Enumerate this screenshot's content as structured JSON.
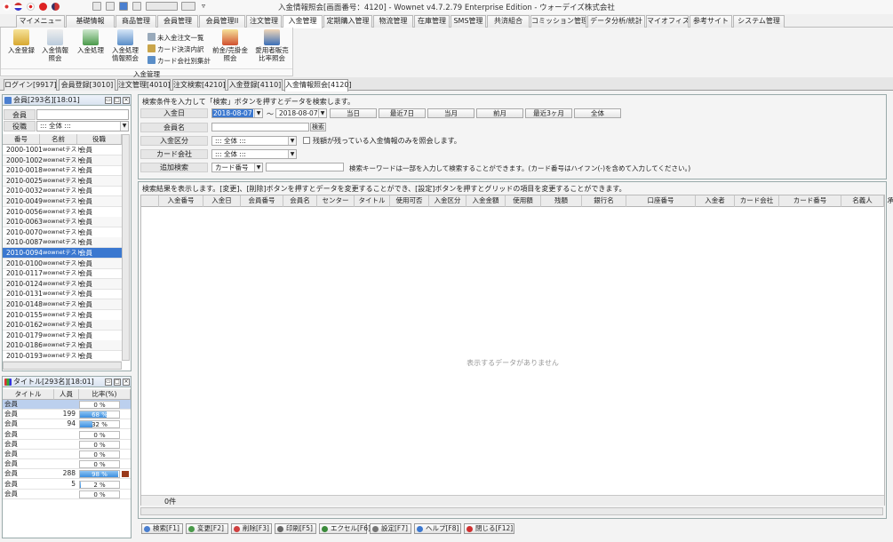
{
  "window": {
    "title": "入金情報照会[画面番号：4120] - Wownet v4.7.2.79 Enterprise Edition - ウォーデイズ株式会社"
  },
  "menu": {
    "tabs": [
      "マイメニュー",
      "基礎情報",
      "商品管理",
      "会員管理",
      "会員管理II",
      "注文管理",
      "入金管理",
      "定期購入管理",
      "物流管理",
      "在庫管理",
      "SMS管理",
      "共済組合",
      "コミッション管理",
      "データ分析/統計",
      "マイオフィス",
      "参考サイト",
      "システム管理"
    ],
    "active": "入金管理"
  },
  "ribbon": {
    "buttons": [
      {
        "label": "入金登録"
      },
      {
        "label": "入金情報\n照会"
      },
      {
        "label": "入金処理"
      },
      {
        "label": "入金処理\n情報照会"
      }
    ],
    "small": [
      "未入金注文一覧",
      "カード決済内訳",
      "カード会社別集計"
    ],
    "right": [
      {
        "label": "前金/売掛金\n照会"
      },
      {
        "label": "愛用者販売\n比率照会"
      }
    ],
    "group": "入金管理"
  },
  "window_tabs": [
    "ログイン[9917]",
    "会員登録[3010]",
    "注文管理[4010]",
    "注文検索[4210]",
    "入金登録[4110]",
    "入金情報照会[4120]"
  ],
  "members_panel": {
    "title": "会員[293名][18:01]",
    "filter_member_label": "会員",
    "filter_role_label": "役職",
    "filter_role_value": "::: 全体 :::",
    "columns": [
      "番号",
      "名前",
      "役職"
    ],
    "rows": [
      [
        "2000-1001",
        "wownetテスト",
        "会員"
      ],
      [
        "2000-1002",
        "wownetテスト",
        "会員"
      ],
      [
        "2010-0018",
        "wownetテスト",
        "会員"
      ],
      [
        "2010-0025",
        "wownetテスト",
        "会員"
      ],
      [
        "2010-0032",
        "wownetテスト",
        "会員"
      ],
      [
        "2010-0049",
        "wownetテスト",
        "会員"
      ],
      [
        "2010-0056",
        "wownetテスト",
        "会員"
      ],
      [
        "2010-0063",
        "wownetテスト",
        "会員"
      ],
      [
        "2010-0070",
        "wownetテスト",
        "会員"
      ],
      [
        "2010-0087",
        "wownetテスト",
        "会員"
      ],
      [
        "2010-0094",
        "wownetテスト",
        "会員"
      ],
      [
        "2010-0100",
        "wownetテスト",
        "会員"
      ],
      [
        "2010-0117",
        "wownetテスト",
        "会員"
      ],
      [
        "2010-0124",
        "wownetテスト",
        "会員"
      ],
      [
        "2010-0131",
        "wownetテスト",
        "会員"
      ],
      [
        "2010-0148",
        "wownetテスト",
        "会員"
      ],
      [
        "2010-0155",
        "wownetテスト",
        "会員"
      ],
      [
        "2010-0162",
        "wownetテスト",
        "会員"
      ],
      [
        "2010-0179",
        "wownetテスト",
        "会員"
      ],
      [
        "2010-0186",
        "wownetテスト",
        "会員"
      ],
      [
        "2010-0193",
        "wownetテスト",
        "会員"
      ]
    ],
    "selected_index": 10
  },
  "title_panel": {
    "title": "タイトル[293名][18:01]",
    "columns": [
      "タイトル",
      "人員",
      "比率(%)"
    ],
    "rows": [
      {
        "name": "会員",
        "count": "",
        "pct": 0,
        "label": "0 %"
      },
      {
        "name": "会員",
        "count": "199",
        "pct": 68,
        "label": "68 %"
      },
      {
        "name": "会員",
        "count": "94",
        "pct": 32,
        "label": "32 %"
      },
      {
        "name": "会員",
        "count": "",
        "pct": 0,
        "label": "0 %"
      },
      {
        "name": "会員",
        "count": "",
        "pct": 0,
        "label": "0 %"
      },
      {
        "name": "会員",
        "count": "",
        "pct": 0,
        "label": "0 %"
      },
      {
        "name": "会員",
        "count": "",
        "pct": 0,
        "label": "0 %"
      },
      {
        "name": "会員",
        "count": "288",
        "pct": 98,
        "label": "98 %"
      },
      {
        "name": "会員",
        "count": "5",
        "pct": 2,
        "label": "2 %"
      },
      {
        "name": "会員",
        "count": "",
        "pct": 0,
        "label": "0 %"
      }
    ]
  },
  "search": {
    "hint": "検索条件を入力して「検索」ボタンを押すとデータを検索します。",
    "date_label": "入金日",
    "date_from": "2018-08-07",
    "tilde": "～",
    "date_to": "2018-08-07",
    "quick": [
      "当日",
      "最近7日",
      "当月",
      "前月",
      "最近3ヶ月",
      "全体"
    ],
    "member_label": "会員名",
    "member_search_btn": "検索",
    "kind_label": "入金区分",
    "kind_value": "::: 全体 :::",
    "remaining_check": "残額が残っている入金情報のみを照会します。",
    "card_label": "カード会社",
    "card_value": "::: 全体 :::",
    "extra_label": "追加検索",
    "extra_field": "カード番号",
    "extra_hint": "検索キーワードは一部を入力して検索することができます。(カード番号はハイフン(-)を含めて入力してください。)"
  },
  "results": {
    "hint": "検索結果を表示します。[変更]、[削除]ボタンを押すとデータを変更することができ、[設定]ボタンを押すとグリッドの項目を変更することができます。",
    "columns": [
      "入金番号",
      "入金日",
      "会員番号",
      "会員名",
      "センター",
      "タイトル",
      "使用可否",
      "入金区分",
      "入金金額",
      "使用額",
      "残額",
      "銀行名",
      "口座番号",
      "入金者",
      "カード会社",
      "カード番号",
      "名義人",
      "承認番号"
    ],
    "empty": "表示するデータがありません",
    "count": "0件"
  },
  "toolbar": [
    "検索[F1]",
    "変更[F2]",
    "削除[F3]",
    "印刷[F5]",
    "エクセル[F6]",
    "設定[F7]",
    "ヘルプ[F8]",
    "閉じる[F12]"
  ],
  "colors": {
    "accent": "#3b78d0",
    "bar": "#3b8ee0",
    "header": "#d9e3f0"
  }
}
